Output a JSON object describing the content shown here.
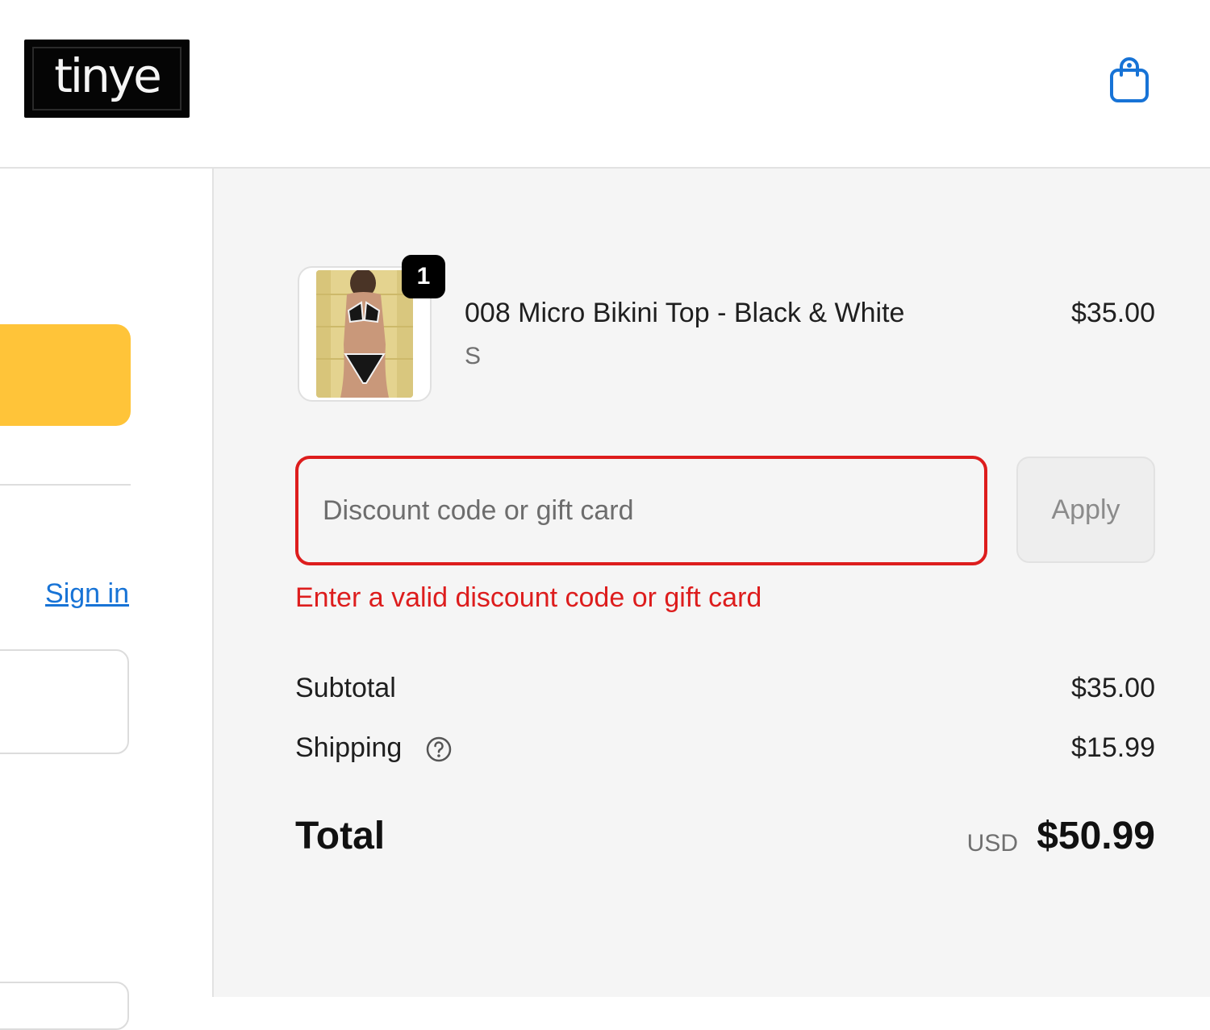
{
  "header": {
    "logo_text": "tinye",
    "cart_icon": "shopping-bag-icon"
  },
  "left": {
    "sign_in_label": "Sign in",
    "express_color": "#ffc439",
    "link_color": "#1773d6"
  },
  "order": {
    "item": {
      "title": "008 Micro Bikini Top - Black & White",
      "variant": "S",
      "price": "$35.00",
      "quantity": "1"
    },
    "discount": {
      "placeholder": "Discount code or gift card",
      "value": "",
      "apply_label": "Apply",
      "error": "Enter a valid discount code or gift card",
      "error_color": "#dd1d1d"
    },
    "subtotal_label": "Subtotal",
    "subtotal_value": "$35.00",
    "shipping_label": "Shipping",
    "shipping_value": "$15.99",
    "shipping_help_icon": "question-circle-icon",
    "total_label": "Total",
    "total_currency": "USD",
    "total_value": "$50.99"
  }
}
